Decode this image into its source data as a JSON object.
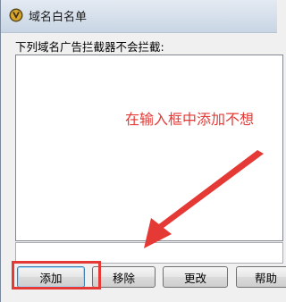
{
  "window": {
    "title": "域名白名单",
    "app_icon": "shield-app-icon"
  },
  "list": {
    "label": "下列域名广告拦截器不会拦截:"
  },
  "input": {
    "value": "",
    "placeholder": ""
  },
  "annotation": {
    "text": "在输入框中添加不想",
    "color": "#e53935"
  },
  "buttons": {
    "add": "添加",
    "remove": "移除",
    "edit": "更改",
    "help": "帮助"
  }
}
